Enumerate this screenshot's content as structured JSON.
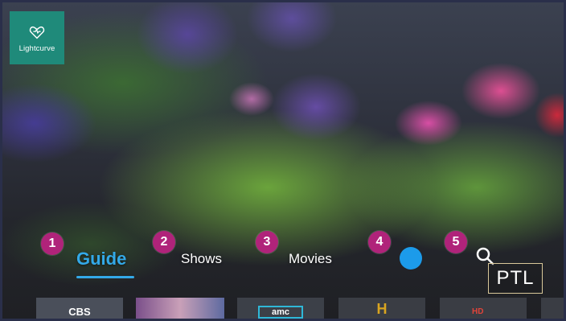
{
  "brand": {
    "name": "Lightcurve"
  },
  "nav": {
    "badges": [
      "1",
      "2",
      "3",
      "4",
      "5"
    ],
    "guide": "Guide",
    "shows": "Shows",
    "movies": "Movies",
    "active": "Guide"
  },
  "search": {
    "icon": "search-icon"
  },
  "profile": {
    "label": "PTL"
  },
  "channels": [
    {
      "label": "CBS",
      "logo": "cbs-eye-icon"
    },
    {
      "label": "",
      "logo": "show-thumbnail"
    },
    {
      "label": "amc",
      "logo": "amc-logo"
    },
    {
      "label": "H",
      "logo": "history-logo"
    },
    {
      "label": "HD",
      "logo": "hd-channel-logo"
    },
    {
      "label": "",
      "logo": "channel-tile"
    }
  ],
  "colors": {
    "accent": "#33a9e8",
    "badge": "#b0237a",
    "brand": "#1f8a7a",
    "dot": "#1c9bea"
  }
}
